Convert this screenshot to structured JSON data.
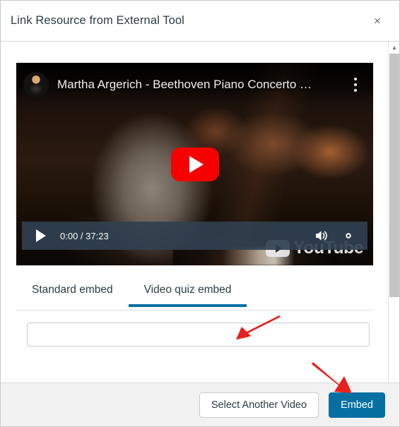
{
  "dialog": {
    "title": "Link Resource from External Tool",
    "close_label": "×",
    "close_icon": "close-icon"
  },
  "video": {
    "title": "Martha Argerich - Beethoven Piano Concerto …",
    "avatar_icon": "channel-avatar",
    "kebab_icon": "more-options-icon",
    "play_overlay_icon": "youtube-play-button",
    "watermark_text": "YouTube",
    "watermark_icon": "youtube-logo-icon",
    "controls": {
      "play_icon": "play-icon",
      "time": "0:00 / 37:23",
      "current_time": "0:00",
      "duration": "37:23",
      "volume_icon": "volume-icon",
      "settings_icon": "gear-icon"
    }
  },
  "tabs": [
    {
      "label": "Standard embed",
      "active": false
    },
    {
      "label": "Video quiz embed",
      "active": true
    }
  ],
  "embed_field": {
    "value": "",
    "placeholder": ""
  },
  "footer": {
    "select_another_label": "Select Another Video",
    "embed_label": "Embed"
  },
  "scrollbars": {
    "vertical_up_icon": "chevron-up-icon",
    "vertical_down_icon": "chevron-down-icon",
    "horizontal_left_icon": "chevron-left-icon",
    "resize_grip_icon": "resize-grip-icon"
  },
  "annotations": [
    {
      "name": "arrow-to-video-quiz-tab",
      "color": "#e8201e",
      "direction": "down-left"
    },
    {
      "name": "arrow-to-embed-button",
      "color": "#e8201e",
      "direction": "down-right"
    }
  ],
  "colors": {
    "accent": "#0770a3",
    "annotation_red": "#e8201e",
    "youtube_red": "#f70000",
    "header_text": "#2d3b45",
    "footer_bg": "#f2f2f2"
  }
}
